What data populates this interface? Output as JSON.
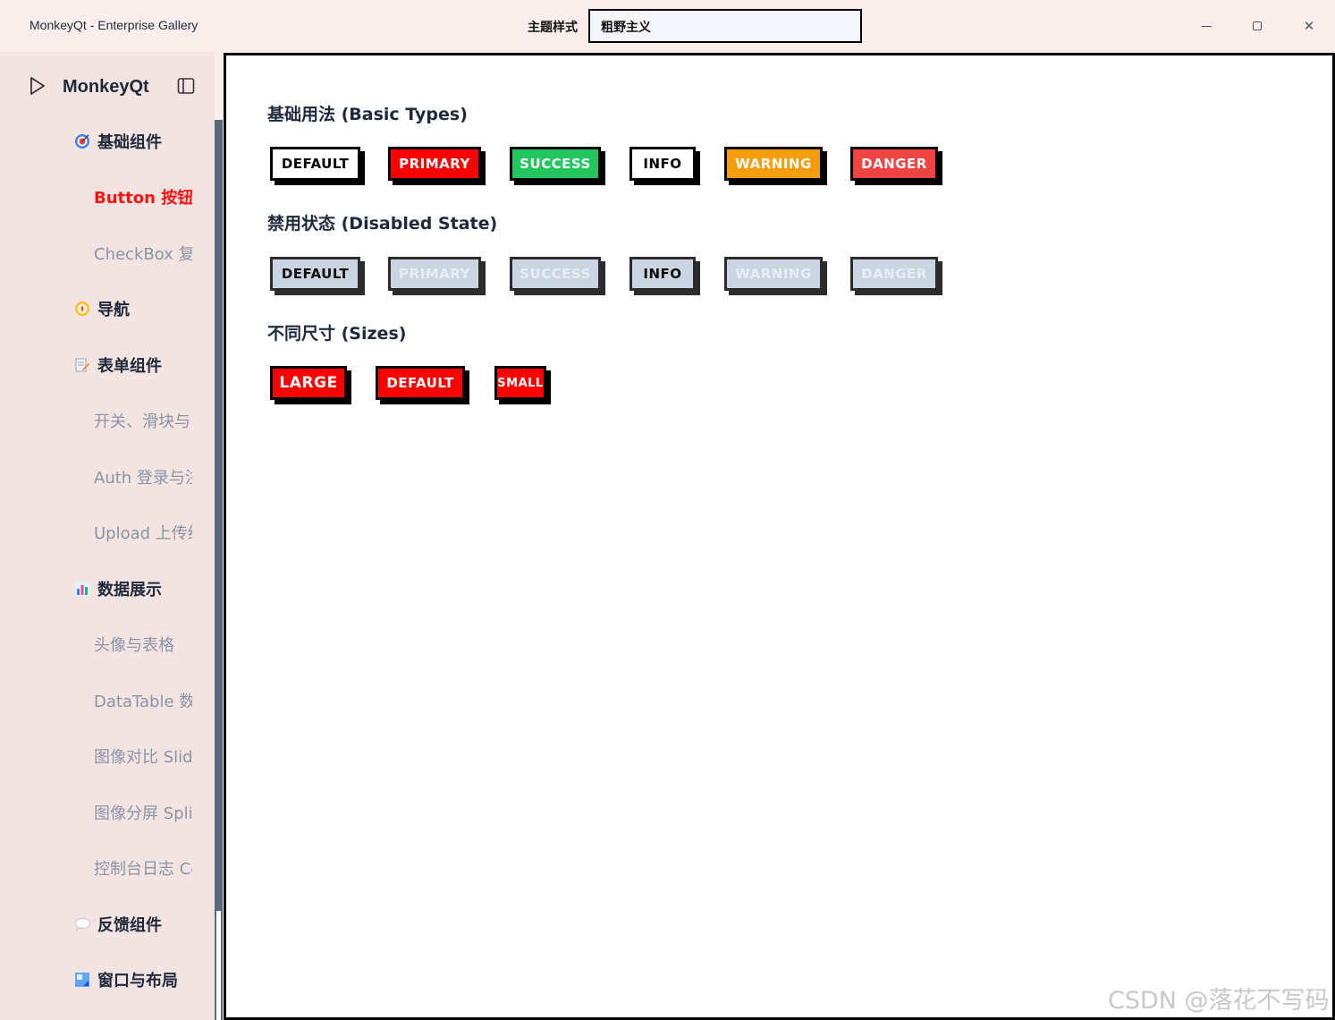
{
  "window": {
    "title": "MonkeyQt - Enterprise Gallery",
    "theme_label": "主题样式",
    "theme_value": "粗野主义"
  },
  "sidebar": {
    "brand": "MonkeyQt",
    "items": [
      {
        "label": "基础组件",
        "type": "group",
        "icon": "target-icon"
      },
      {
        "label": "Button 按钮",
        "type": "sub",
        "active": true
      },
      {
        "label": "CheckBox 复选",
        "type": "sub"
      },
      {
        "label": "导航",
        "type": "group",
        "icon": "compass-icon"
      },
      {
        "label": "表单组件",
        "type": "group",
        "icon": "form-edit-icon"
      },
      {
        "label": "开关、滑块与日",
        "type": "sub"
      },
      {
        "label": "Auth 登录与注",
        "type": "sub"
      },
      {
        "label": "Upload 上传组",
        "type": "sub"
      },
      {
        "label": "数据展示",
        "type": "group",
        "icon": "bar-chart-icon"
      },
      {
        "label": "头像与表格",
        "type": "sub"
      },
      {
        "label": "DataTable 数据",
        "type": "sub"
      },
      {
        "label": "图像对比 Slide",
        "type": "sub"
      },
      {
        "label": "图像分屏 Split",
        "type": "sub"
      },
      {
        "label": "控制台日志 Co",
        "type": "sub"
      },
      {
        "label": "反馈组件",
        "type": "group",
        "icon": "speech-bubble-icon"
      },
      {
        "label": "窗口与布局",
        "type": "group",
        "icon": "window-layout-icon"
      }
    ]
  },
  "main": {
    "sections": [
      {
        "title": "基础用法 (Basic Types)",
        "buttons": [
          {
            "label": "DEFAULT",
            "variant": "default"
          },
          {
            "label": "PRIMARY",
            "variant": "primary"
          },
          {
            "label": "SUCCESS",
            "variant": "success"
          },
          {
            "label": "INFO",
            "variant": "info"
          },
          {
            "label": "WARNING",
            "variant": "warning"
          },
          {
            "label": "DANGER",
            "variant": "danger"
          }
        ]
      },
      {
        "title": "禁用状态 (Disabled State)",
        "buttons": [
          {
            "label": "DEFAULT",
            "variant": "default",
            "disabled": true
          },
          {
            "label": "PRIMARY",
            "variant": "primary",
            "disabled": true
          },
          {
            "label": "SUCCESS",
            "variant": "success",
            "disabled": true
          },
          {
            "label": "INFO",
            "variant": "info",
            "disabled": true
          },
          {
            "label": "WARNING",
            "variant": "warning",
            "disabled": true
          },
          {
            "label": "DANGER",
            "variant": "danger",
            "disabled": true
          }
        ]
      },
      {
        "title": "不同尺寸 (Sizes)",
        "buttons": [
          {
            "label": "LARGE",
            "size": "large"
          },
          {
            "label": "DEFAULT",
            "size": "default"
          },
          {
            "label": "SMALL",
            "size": "small"
          }
        ]
      }
    ]
  },
  "watermark": "CSDN @落花不写码",
  "colors": {
    "primary": "#ff0000",
    "success": "#22c55e",
    "warning": "#f59e0b",
    "danger": "#ef4444",
    "disabled": "#cbd5e1",
    "active_nav": "#ff1111",
    "chrome_bg": "#f9eeec"
  }
}
